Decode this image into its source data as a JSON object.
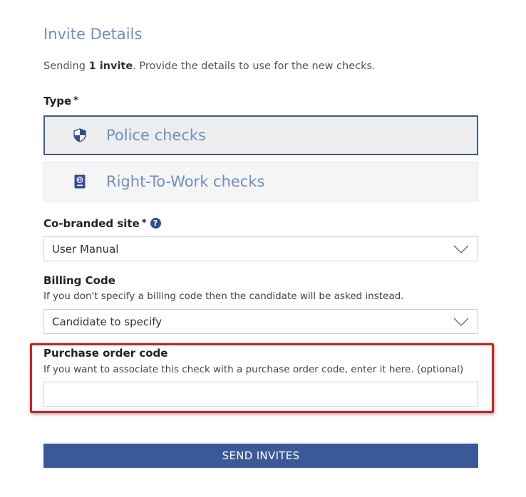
{
  "form": {
    "heading": "Invite Details",
    "intro": {
      "prefix": "Sending ",
      "count": "1 invite",
      "suffix": ". Provide the details to use for the new checks."
    },
    "type": {
      "label": "Type",
      "required_marker": "*",
      "options": [
        {
          "label": "Police checks",
          "icon": "shield-icon",
          "selected": true
        },
        {
          "label": "Right-To-Work checks",
          "icon": "passport-icon",
          "selected": false
        }
      ]
    },
    "cobranded_site": {
      "label": "Co-branded site",
      "required_marker": "*",
      "help_icon": "?",
      "value": "User Manual"
    },
    "billing_code": {
      "label": "Billing Code",
      "help": "If you don't specify a billing code then the candidate will be asked instead.",
      "value": "Candidate to specify"
    },
    "purchase_order": {
      "label": "Purchase order code",
      "help": "If you want to associate this check with a purchase order code, enter it here. (optional)",
      "value": "",
      "placeholder": ""
    },
    "submit_label": "SEND INVITES"
  },
  "colors": {
    "accent": "#6d8fc4",
    "selected_border": "#3d5a94",
    "button": "#3b5998",
    "highlight": "#e01a1a"
  }
}
